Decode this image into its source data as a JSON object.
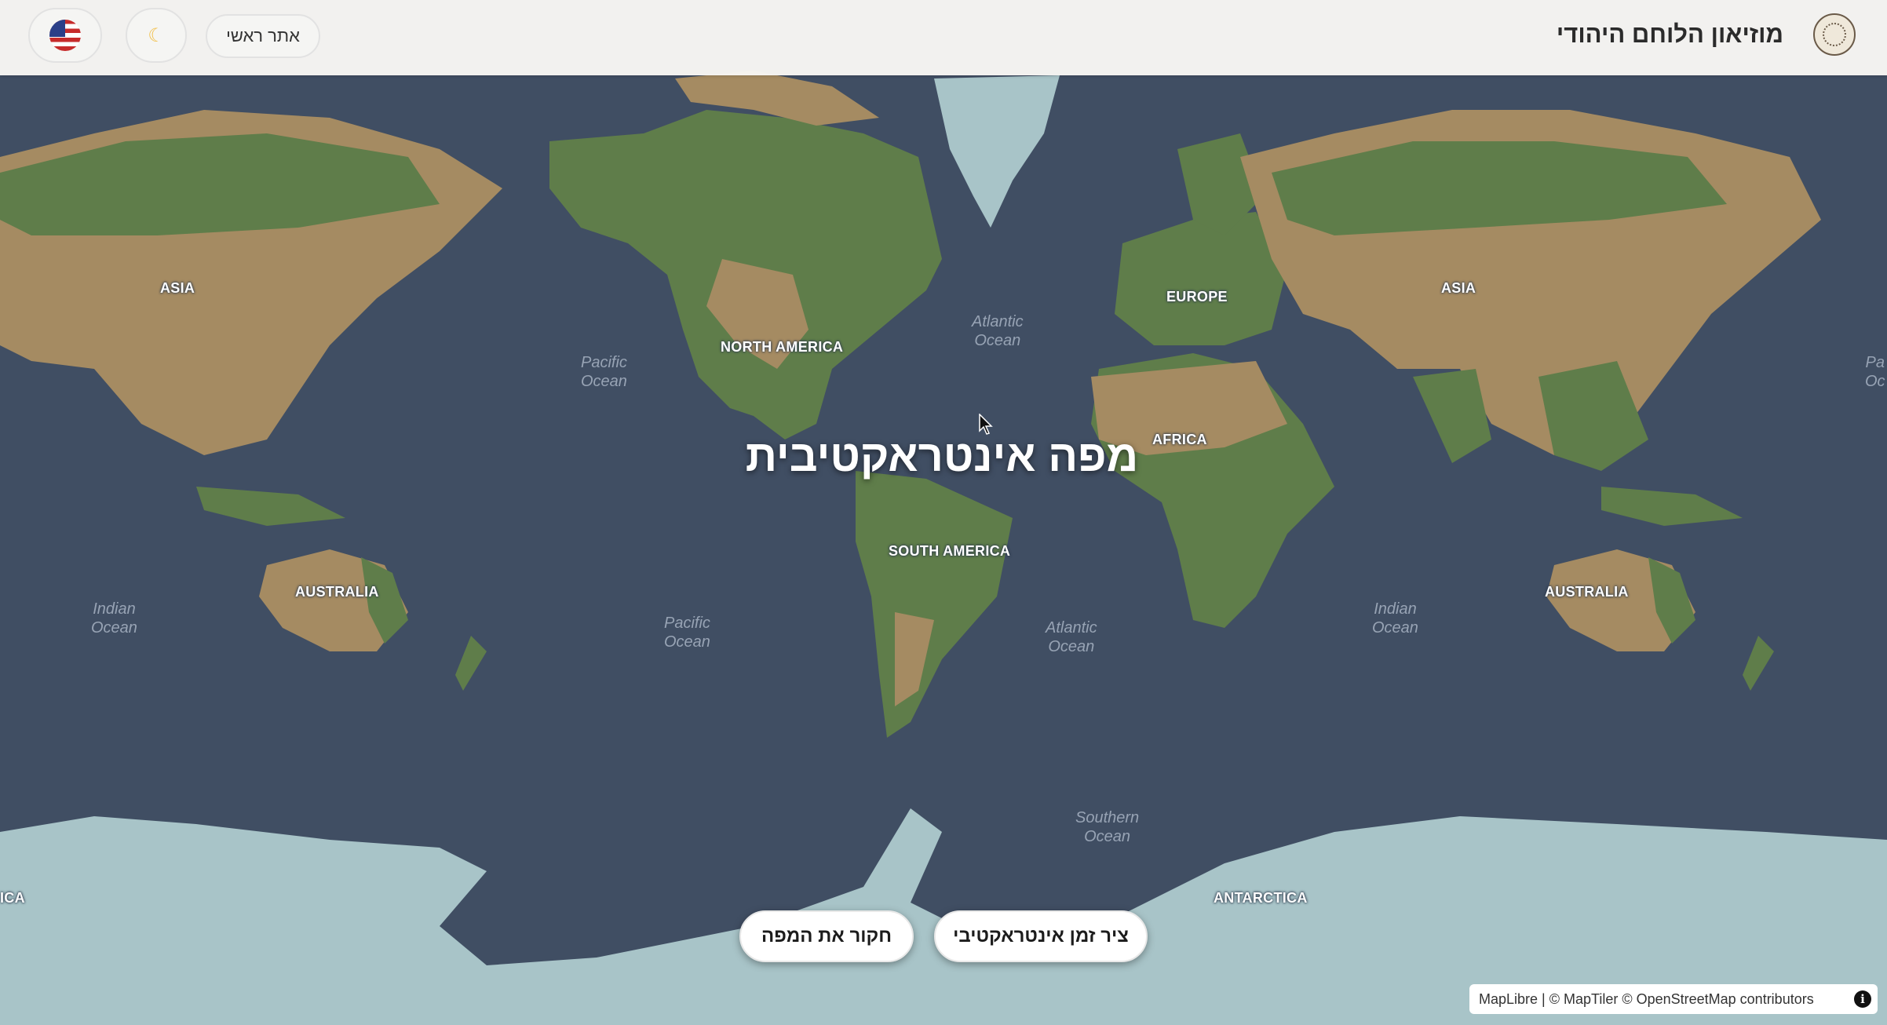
{
  "header": {
    "site_title": "מוזיאון הלוחם היהודי",
    "home_link": "אתר ראשי",
    "theme_icon": "moon-icon",
    "language_flag": "us-flag-icon"
  },
  "hero": {
    "title": "מפה אינטראקטיבית"
  },
  "buttons": {
    "explore": "חקור את המפה",
    "timeline": "ציר זמן אינטראקטיבי"
  },
  "map": {
    "continents": {
      "asia_west": "ASIA",
      "asia_east": "ASIA",
      "north_america": "NORTH AMERICA",
      "europe": "EUROPE",
      "africa": "AFRICA",
      "south_america": "SOUTH AMERICA",
      "australia_west": "AUSTRALIA",
      "australia_east": "AUSTRALIA",
      "antarctica": "ANTARCTICA",
      "antarctica_edge": "ICA"
    },
    "oceans": {
      "pacific_north": "Pacific\nOcean",
      "atlantic_north": "Atlantic\nOcean",
      "pacific_south": "Pacific\nOcean",
      "atlantic_south": "Atlantic\nOcean",
      "indian_west": "Indian\nOcean",
      "indian_east": "Indian\nOcean",
      "southern": "Southern\nOcean",
      "pacific_edge": "Pa\nOc"
    },
    "colors": {
      "ocean": "#404e63",
      "land_desert": "#a58b62",
      "land_forest": "#5f7d4a",
      "land_dense_forest": "#3e5a30",
      "ice": "#a8c4c8"
    }
  },
  "attribution": {
    "text": "MapLibre | © MapTiler © OpenStreetMap contributors",
    "info_icon": "info-icon"
  }
}
